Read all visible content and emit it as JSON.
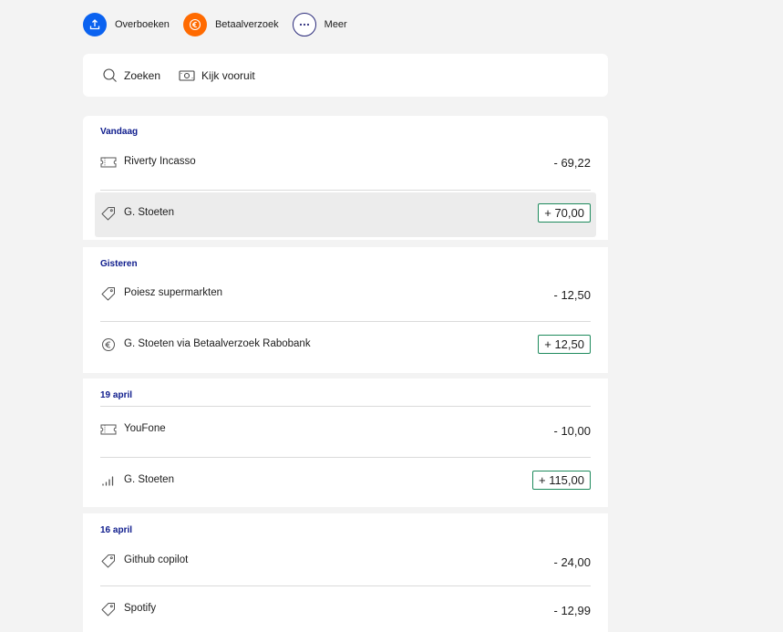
{
  "actions": {
    "transfer_label": "Overboeken",
    "payment_request_label": "Betaalverzoek",
    "more_label": "Meer"
  },
  "tools": {
    "search_label": "Zoeken",
    "look_ahead_label": "Kijk vooruit"
  },
  "groups": [
    {
      "date": "Vandaag",
      "transactions": [
        {
          "name": "Riverty Incasso",
          "amount": "- 69,22",
          "icon": "ticket-icon",
          "positive": false
        },
        {
          "name": "G. Stoeten",
          "amount": "+ 70,00",
          "icon": "tag-icon",
          "positive": true,
          "selected": true
        }
      ]
    },
    {
      "date": "Gisteren",
      "transactions": [
        {
          "name": "Poiesz supermarkten",
          "amount": "- 12,50",
          "icon": "tag-icon",
          "positive": false
        },
        {
          "name": "G. Stoeten via Betaalverzoek Rabobank",
          "amount": "+ 12,50",
          "icon": "euro-icon",
          "positive": true
        }
      ]
    },
    {
      "date": "19 april",
      "transactions": [
        {
          "name": "YouFone",
          "amount": "- 10,00",
          "icon": "ticket-icon",
          "positive": false
        },
        {
          "name": "G. Stoeten",
          "amount": "+ 115,00",
          "icon": "signal-bars-icon",
          "positive": true
        }
      ]
    },
    {
      "date": "16 april",
      "transactions": [
        {
          "name": "Github copilot",
          "amount": "- 24,00",
          "icon": "tag-icon",
          "positive": false
        },
        {
          "name": "Spotify",
          "amount": "- 12,99",
          "icon": "tag-icon",
          "positive": false
        }
      ]
    }
  ],
  "colors": {
    "primary_blue": "#0a62f0",
    "accent_orange": "#ff6a00",
    "date_header": "#0d1b8c",
    "positive_border": "#1d8a5c",
    "background": "#f3f3f3"
  }
}
